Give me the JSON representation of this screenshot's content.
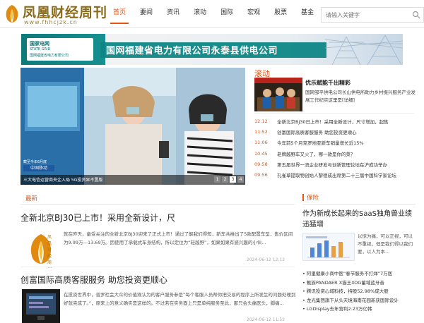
{
  "site": {
    "logo_text": "凤凰财经周刊",
    "logo_url": "www.fhhcjzk.cn"
  },
  "nav": {
    "items": [
      "首页",
      "要闻",
      "资讯",
      "滚动",
      "国际",
      "宏观",
      "股票",
      "基金"
    ],
    "active_index": 0
  },
  "search": {
    "placeholder": "请输入关键字"
  },
  "banner": {
    "logo_line1": "国家电网",
    "logo_line2": "STATE GRID",
    "logo_line3": "国网福建省电力有限公司",
    "title": "国网福建省电力有限公司永泰县供电公司"
  },
  "slider": {
    "caption": "三大电信运营商央企入局 5G投资显不置版",
    "badge_small": "截至今年6月底",
    "badge": "中国移动",
    "pages": [
      "1",
      "2",
      "3",
      "4"
    ],
    "active_page": "3"
  },
  "rolling": {
    "header": "滚动",
    "featured": {
      "title": "优乐赋能千出精彩",
      "desc": "国网邹平供电公司长山供电所助力乡村振兴服务产业发展工作纪实这里是[详细]"
    },
    "items": [
      {
        "time": "12:12",
        "text": "全新北京BJ30已上市！采用全新设计，尺寸增加，起售"
      },
      {
        "time": "11:52",
        "text": "创富国际高质客服服务 助您投资更顺心"
      },
      {
        "time": "11:06",
        "text": "今年前5个月克罗地亚新车销量增长近15%"
      },
      {
        "time": "10:45",
        "text": "老牌越野车又火了，哪一款是你的菜？"
      },
      {
        "time": "09:58",
        "text": "第五届世界一流企业研发与创新管理论坛在沪成功举办"
      },
      {
        "time": "09:56",
        "text": "孔雀草提取物创始人黎德成出席第二十三届中国科学家论坛"
      }
    ]
  },
  "latest": {
    "header": "最新",
    "articles": [
      {
        "title": "全新北京BJ30已上市！采用全新设计，尺",
        "thumb_text": "凤凰财经周刊",
        "body": "就在昨天，备受关注的全新北京BJ30迎来了正式上市！通过了解我们得知，新车共推出了5款配置车型，售价区间为9.99万—13.69万。因使用了承载式车身结构，所以定位为“轻越野”，如果如果有感兴趣的小伙...",
        "time": "2024-06-12 12:12"
      },
      {
        "title": "创富国际高质客服服务 助您投资更顺心",
        "body": "在投资世界中，普罗社会大众的价值观认为的客户服务参是“每个客服人员帮你把交易的程序上所发生的问题处理到好就完成了。”，原来上的意义确实是这样的。不过若在实务面上只是单纯服务至此，那只会头痛医头，脚痛...",
        "time": "2024-06-12 11:52"
      }
    ]
  },
  "insurance": {
    "header": "保险",
    "title": "作为新成长起来的SaaS独角兽业绩迅猛增",
    "desc": "以惊为痛，可以正视，可以不重视，但是我们得以我们要，以人为本...",
    "items": [
      "阿里健康小商中医“春节服务不打烊”7万医",
      "魅族PANDAER X猫王XOG蓄域蓝牙音",
      "腾讯投资心域科技，持股52.98%成大股",
      "龙光集团旗下从头天境海南花园新获国际设计",
      "LGDisplay去年营利2.23万亿韩"
    ]
  },
  "colors": {
    "accent": "#e8520f",
    "brand_gold": "#8a6b1a",
    "grid_teal": "#0e8686"
  }
}
